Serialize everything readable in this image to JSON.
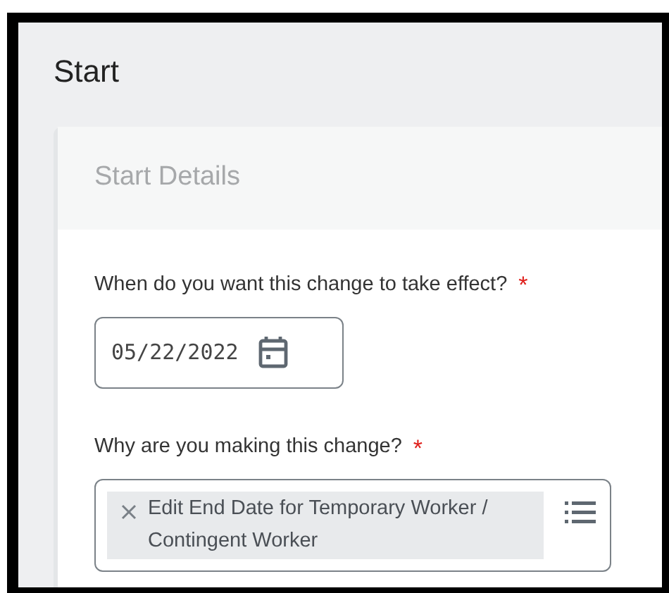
{
  "page": {
    "title": "Start"
  },
  "card": {
    "title": "Start Details"
  },
  "fields": [
    {
      "kind": "date",
      "label": "When do you want this change to take effect?",
      "required_mark": "*",
      "value": "05/22/2022"
    },
    {
      "kind": "multiselect",
      "label": "Why are you making this change?",
      "required_mark": "*",
      "chips": [
        "Edit End Date for Temporary Worker / Contingent Worker"
      ]
    }
  ]
}
